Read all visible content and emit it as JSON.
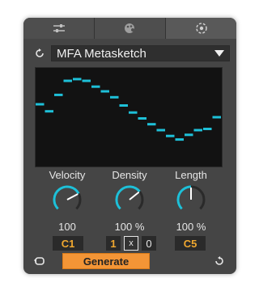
{
  "tabs": [
    {
      "icon": "sliders-icon",
      "active": false
    },
    {
      "icon": "palette-icon",
      "active": false
    },
    {
      "icon": "target-icon",
      "active": true
    }
  ],
  "preset": {
    "name": "MFA Metasketch"
  },
  "curve": {
    "color": "#1ec0d8",
    "steps": [
      0.55,
      0.25,
      0.95,
      1.55,
      1.62,
      1.55,
      1.3,
      1.1,
      0.85,
      0.5,
      0.2,
      -0.05,
      -0.3,
      -0.55,
      -0.8,
      -0.95,
      -0.75,
      -0.55,
      -0.5,
      0.0
    ]
  },
  "knobs": [
    {
      "label": "Velocity",
      "value": "100",
      "fraction": 0.73
    },
    {
      "label": "Density",
      "value": "100 %",
      "fraction": 0.69
    },
    {
      "label": "Length",
      "value": "100 %",
      "fraction": 0.5
    }
  ],
  "notes": {
    "low": "C1",
    "high": "C5"
  },
  "density": {
    "left": "1",
    "mult": "x",
    "right": "0"
  },
  "generate": {
    "label": "Generate"
  },
  "colors": {
    "accent": "#f39536",
    "knob": "#1ec0d8",
    "note": "#f0a830"
  }
}
